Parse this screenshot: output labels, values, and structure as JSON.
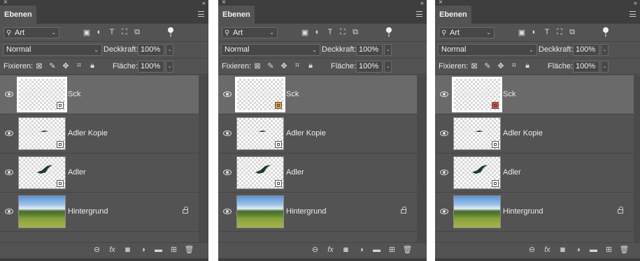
{
  "panels": [
    {
      "tab_title": "Ebenen",
      "filter": {
        "value": "Art"
      },
      "blend_mode": "Normal",
      "opacity_label": "Deckkraft:",
      "opacity_value": "100%",
      "lock_label": "Fixieren:",
      "fill_label": "Fläche:",
      "fill_value": "100%",
      "layers": [
        {
          "name": "Sck",
          "selected": true,
          "thumb": "blank",
          "badge": "smart"
        },
        {
          "name": "Adler Kopie",
          "selected": false,
          "thumb": "bird-small",
          "badge": "smart"
        },
        {
          "name": "Adler",
          "selected": false,
          "thumb": "bird",
          "badge": "smart"
        },
        {
          "name": "Hintergrund",
          "selected": false,
          "thumb": "landscape",
          "locked": true
        }
      ]
    },
    {
      "tab_title": "Ebenen",
      "filter": {
        "value": "Art"
      },
      "blend_mode": "Normal",
      "opacity_label": "Deckkraft:",
      "opacity_value": "100%",
      "lock_label": "Fixieren:",
      "fill_label": "Fläche:",
      "fill_value": "100%",
      "layers": [
        {
          "name": "Sck",
          "selected": true,
          "thumb": "blank",
          "badge": "warn"
        },
        {
          "name": "Adler Kopie",
          "selected": false,
          "thumb": "bird-small",
          "badge": "smart"
        },
        {
          "name": "Adler",
          "selected": false,
          "thumb": "bird",
          "badge": "smart"
        },
        {
          "name": "Hintergrund",
          "selected": false,
          "thumb": "landscape",
          "locked": true
        }
      ]
    },
    {
      "tab_title": "Ebenen",
      "filter": {
        "value": "Art"
      },
      "blend_mode": "Normal",
      "opacity_label": "Deckkraft:",
      "opacity_value": "100%",
      "lock_label": "Fixieren:",
      "fill_label": "Fläche:",
      "fill_value": "100%",
      "layers": [
        {
          "name": "Sck",
          "selected": true,
          "thumb": "blank",
          "badge": "error"
        },
        {
          "name": "Adler Kopie",
          "selected": false,
          "thumb": "bird-small",
          "badge": "smart"
        },
        {
          "name": "Adler",
          "selected": false,
          "thumb": "bird",
          "badge": "smart"
        },
        {
          "name": "Hintergrund",
          "selected": false,
          "thumb": "landscape",
          "locked": true
        }
      ]
    }
  ],
  "colors": {
    "panel_bg": "#535353",
    "tab_strip": "#3e3e3e",
    "selected_row": "#6a6a6a",
    "warn_badge": "#e0a53a",
    "error_badge": "#d64b3b"
  },
  "icons": {
    "filter_row": [
      "image-filter-icon",
      "adjustment-filter-icon",
      "type-filter-icon",
      "shape-filter-icon",
      "smart-object-filter-icon"
    ],
    "lock_row": [
      "lock-transparent-pixels-icon",
      "lock-image-pixels-icon",
      "lock-position-icon",
      "lock-artboard-icon",
      "lock-all-icon"
    ],
    "footer": [
      "link-layers-icon",
      "fx-icon",
      "add-mask-icon",
      "adjustment-layer-icon",
      "group-folder-icon",
      "new-layer-icon",
      "trash-icon"
    ]
  }
}
